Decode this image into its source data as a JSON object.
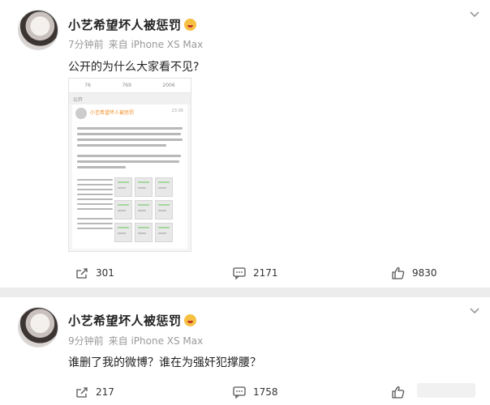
{
  "posts": [
    {
      "username": "小艺希望坏人被惩罚",
      "time": "7分钟前",
      "source": "来自 iPhone XS Max",
      "text": "公开的为什么大家看不见?",
      "embed": {
        "stats": [
          "76",
          "769",
          "2006"
        ],
        "public_label": "公开",
        "inner_name": "小艺希望坏人被惩罚",
        "inner_time": "23:06"
      },
      "share_count": "301",
      "comment_count": "2171",
      "like_count": "9830"
    },
    {
      "username": "小艺希望坏人被惩罚",
      "time": "9分钟前",
      "source": "来自 iPhone XS Max",
      "text": "谁删了我的微博？谁在为强奸犯撑腰？",
      "share_count": "217",
      "comment_count": "1758",
      "like_count": ""
    }
  ],
  "icons": {
    "more": "chevron-down-icon",
    "share": "share-icon",
    "comment": "comment-icon",
    "like": "like-icon",
    "emoji": "crying-face-icon"
  },
  "colors": {
    "username": "#222222",
    "meta": "#999999",
    "embed_name": "#f08a24"
  }
}
